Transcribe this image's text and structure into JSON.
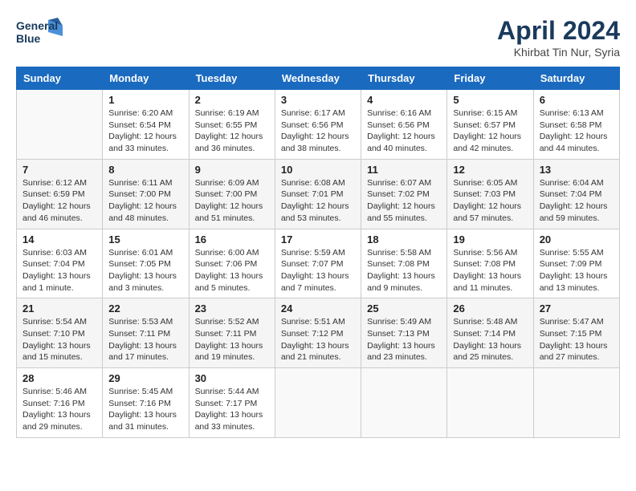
{
  "header": {
    "logo_line1": "General",
    "logo_line2": "Blue",
    "title": "April 2024",
    "location": "Khirbat Tin Nur, Syria"
  },
  "weekdays": [
    "Sunday",
    "Monday",
    "Tuesday",
    "Wednesday",
    "Thursday",
    "Friday",
    "Saturday"
  ],
  "weeks": [
    [
      {
        "day": "",
        "info": ""
      },
      {
        "day": "1",
        "info": "Sunrise: 6:20 AM\nSunset: 6:54 PM\nDaylight: 12 hours\nand 33 minutes."
      },
      {
        "day": "2",
        "info": "Sunrise: 6:19 AM\nSunset: 6:55 PM\nDaylight: 12 hours\nand 36 minutes."
      },
      {
        "day": "3",
        "info": "Sunrise: 6:17 AM\nSunset: 6:56 PM\nDaylight: 12 hours\nand 38 minutes."
      },
      {
        "day": "4",
        "info": "Sunrise: 6:16 AM\nSunset: 6:56 PM\nDaylight: 12 hours\nand 40 minutes."
      },
      {
        "day": "5",
        "info": "Sunrise: 6:15 AM\nSunset: 6:57 PM\nDaylight: 12 hours\nand 42 minutes."
      },
      {
        "day": "6",
        "info": "Sunrise: 6:13 AM\nSunset: 6:58 PM\nDaylight: 12 hours\nand 44 minutes."
      }
    ],
    [
      {
        "day": "7",
        "info": "Sunrise: 6:12 AM\nSunset: 6:59 PM\nDaylight: 12 hours\nand 46 minutes."
      },
      {
        "day": "8",
        "info": "Sunrise: 6:11 AM\nSunset: 7:00 PM\nDaylight: 12 hours\nand 48 minutes."
      },
      {
        "day": "9",
        "info": "Sunrise: 6:09 AM\nSunset: 7:00 PM\nDaylight: 12 hours\nand 51 minutes."
      },
      {
        "day": "10",
        "info": "Sunrise: 6:08 AM\nSunset: 7:01 PM\nDaylight: 12 hours\nand 53 minutes."
      },
      {
        "day": "11",
        "info": "Sunrise: 6:07 AM\nSunset: 7:02 PM\nDaylight: 12 hours\nand 55 minutes."
      },
      {
        "day": "12",
        "info": "Sunrise: 6:05 AM\nSunset: 7:03 PM\nDaylight: 12 hours\nand 57 minutes."
      },
      {
        "day": "13",
        "info": "Sunrise: 6:04 AM\nSunset: 7:04 PM\nDaylight: 12 hours\nand 59 minutes."
      }
    ],
    [
      {
        "day": "14",
        "info": "Sunrise: 6:03 AM\nSunset: 7:04 PM\nDaylight: 13 hours\nand 1 minute."
      },
      {
        "day": "15",
        "info": "Sunrise: 6:01 AM\nSunset: 7:05 PM\nDaylight: 13 hours\nand 3 minutes."
      },
      {
        "day": "16",
        "info": "Sunrise: 6:00 AM\nSunset: 7:06 PM\nDaylight: 13 hours\nand 5 minutes."
      },
      {
        "day": "17",
        "info": "Sunrise: 5:59 AM\nSunset: 7:07 PM\nDaylight: 13 hours\nand 7 minutes."
      },
      {
        "day": "18",
        "info": "Sunrise: 5:58 AM\nSunset: 7:08 PM\nDaylight: 13 hours\nand 9 minutes."
      },
      {
        "day": "19",
        "info": "Sunrise: 5:56 AM\nSunset: 7:08 PM\nDaylight: 13 hours\nand 11 minutes."
      },
      {
        "day": "20",
        "info": "Sunrise: 5:55 AM\nSunset: 7:09 PM\nDaylight: 13 hours\nand 13 minutes."
      }
    ],
    [
      {
        "day": "21",
        "info": "Sunrise: 5:54 AM\nSunset: 7:10 PM\nDaylight: 13 hours\nand 15 minutes."
      },
      {
        "day": "22",
        "info": "Sunrise: 5:53 AM\nSunset: 7:11 PM\nDaylight: 13 hours\nand 17 minutes."
      },
      {
        "day": "23",
        "info": "Sunrise: 5:52 AM\nSunset: 7:11 PM\nDaylight: 13 hours\nand 19 minutes."
      },
      {
        "day": "24",
        "info": "Sunrise: 5:51 AM\nSunset: 7:12 PM\nDaylight: 13 hours\nand 21 minutes."
      },
      {
        "day": "25",
        "info": "Sunrise: 5:49 AM\nSunset: 7:13 PM\nDaylight: 13 hours\nand 23 minutes."
      },
      {
        "day": "26",
        "info": "Sunrise: 5:48 AM\nSunset: 7:14 PM\nDaylight: 13 hours\nand 25 minutes."
      },
      {
        "day": "27",
        "info": "Sunrise: 5:47 AM\nSunset: 7:15 PM\nDaylight: 13 hours\nand 27 minutes."
      }
    ],
    [
      {
        "day": "28",
        "info": "Sunrise: 5:46 AM\nSunset: 7:16 PM\nDaylight: 13 hours\nand 29 minutes."
      },
      {
        "day": "29",
        "info": "Sunrise: 5:45 AM\nSunset: 7:16 PM\nDaylight: 13 hours\nand 31 minutes."
      },
      {
        "day": "30",
        "info": "Sunrise: 5:44 AM\nSunset: 7:17 PM\nDaylight: 13 hours\nand 33 minutes."
      },
      {
        "day": "",
        "info": ""
      },
      {
        "day": "",
        "info": ""
      },
      {
        "day": "",
        "info": ""
      },
      {
        "day": "",
        "info": ""
      }
    ]
  ]
}
